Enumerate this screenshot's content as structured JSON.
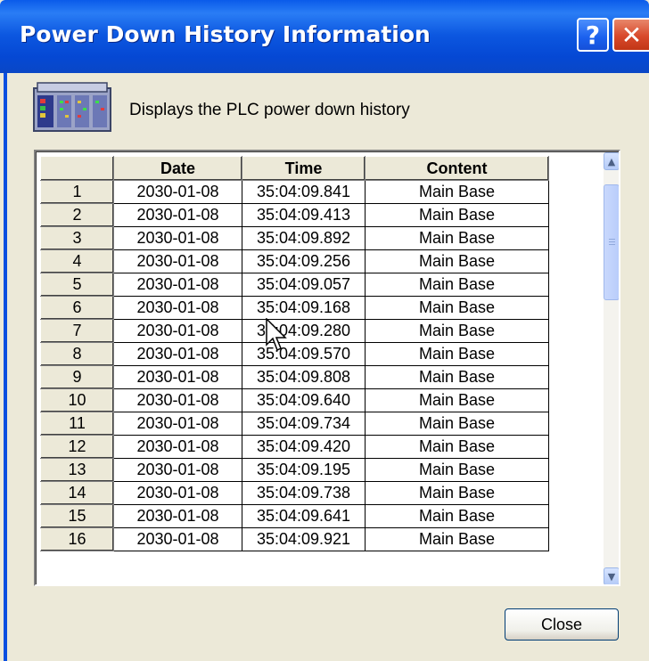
{
  "window": {
    "title": "Power Down History Information",
    "help_label": "?",
    "close_label": "✕"
  },
  "header": {
    "icon": "plc-rack-icon",
    "description": "Displays the PLC power down history"
  },
  "table": {
    "columns": [
      "",
      "Date",
      "Time",
      "Content"
    ],
    "rows": [
      {
        "index": "1",
        "date": "2030-01-08",
        "time": "35:04:09.841",
        "content": "Main Base"
      },
      {
        "index": "2",
        "date": "2030-01-08",
        "time": "35:04:09.413",
        "content": "Main Base"
      },
      {
        "index": "3",
        "date": "2030-01-08",
        "time": "35:04:09.892",
        "content": "Main Base"
      },
      {
        "index": "4",
        "date": "2030-01-08",
        "time": "35:04:09.256",
        "content": "Main Base"
      },
      {
        "index": "5",
        "date": "2030-01-08",
        "time": "35:04:09.057",
        "content": "Main Base"
      },
      {
        "index": "6",
        "date": "2030-01-08",
        "time": "35:04:09.168",
        "content": "Main Base"
      },
      {
        "index": "7",
        "date": "2030-01-08",
        "time": "35:04:09.280",
        "content": "Main Base"
      },
      {
        "index": "8",
        "date": "2030-01-08",
        "time": "35:04:09.570",
        "content": "Main Base"
      },
      {
        "index": "9",
        "date": "2030-01-08",
        "time": "35:04:09.808",
        "content": "Main Base"
      },
      {
        "index": "10",
        "date": "2030-01-08",
        "time": "35:04:09.640",
        "content": "Main Base"
      },
      {
        "index": "11",
        "date": "2030-01-08",
        "time": "35:04:09.734",
        "content": "Main Base"
      },
      {
        "index": "12",
        "date": "2030-01-08",
        "time": "35:04:09.420",
        "content": "Main Base"
      },
      {
        "index": "13",
        "date": "2030-01-08",
        "time": "35:04:09.195",
        "content": "Main Base"
      },
      {
        "index": "14",
        "date": "2030-01-08",
        "time": "35:04:09.738",
        "content": "Main Base"
      },
      {
        "index": "15",
        "date": "2030-01-08",
        "time": "35:04:09.641",
        "content": "Main Base"
      },
      {
        "index": "16",
        "date": "2030-01-08",
        "time": "35:04:09.921",
        "content": "Main Base"
      }
    ]
  },
  "scrollbar": {
    "up_icon": "▲",
    "down_icon": "▼"
  },
  "footer": {
    "close_button": "Close"
  },
  "colors": {
    "titlebar": "#0A5BEA",
    "face": "#ECE9D8",
    "close_red": "#D8492B"
  }
}
